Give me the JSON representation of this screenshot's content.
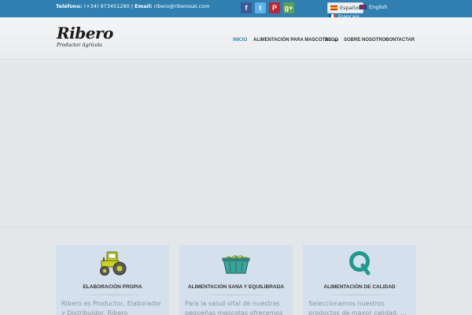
{
  "topbar": {
    "phone_label": "Teléfono:",
    "phone_value": "(+34) 973451280",
    "separator": "|",
    "email_label": "Email:",
    "email_value": "ribero@riberosat.com",
    "socials": [
      {
        "name": "facebook-icon",
        "glyph": "f"
      },
      {
        "name": "twitter-icon",
        "glyph": "t"
      },
      {
        "name": "pinterest-icon",
        "glyph": "P"
      },
      {
        "name": "googleplus-icon",
        "glyph": "g+"
      }
    ],
    "languages": {
      "es": "Español",
      "en": "English",
      "fr": "Français"
    }
  },
  "header": {
    "logo_main": "Ribero",
    "logo_sub": "Productor Agrícola",
    "nav": {
      "inicio": "INICIO",
      "alimentacion": "ALIMENTACIÓN PARA MASCOTAS",
      "blog": "BLOG",
      "sobre": "SOBRE NOSOTROS",
      "contactar": "CONTACTAR"
    }
  },
  "features": [
    {
      "icon": "tractor-icon",
      "title": "ELABORACIÓN PROPIA",
      "text": "Ribero es Productor, Elaborador y Distribuidor. Ribero Productor..."
    },
    {
      "icon": "feed-container-icon",
      "title": "ALIMENTACIÓN SANA Y EQUILIBRADA",
      "text": "Para la salud vital de nuestras pequeñas mascotas ofrecemos una..."
    },
    {
      "icon": "quality-q-icon",
      "title": "ALIMENTACIÓN DE CALIDAD",
      "text": "Seleccionamos nuestros productos de mayor calidad. ..."
    }
  ],
  "colors": {
    "topbar": "#2f80b0",
    "accent": "#2f80b0",
    "card": "#d4e0ec",
    "quality_icon": "#1f9a8e"
  }
}
